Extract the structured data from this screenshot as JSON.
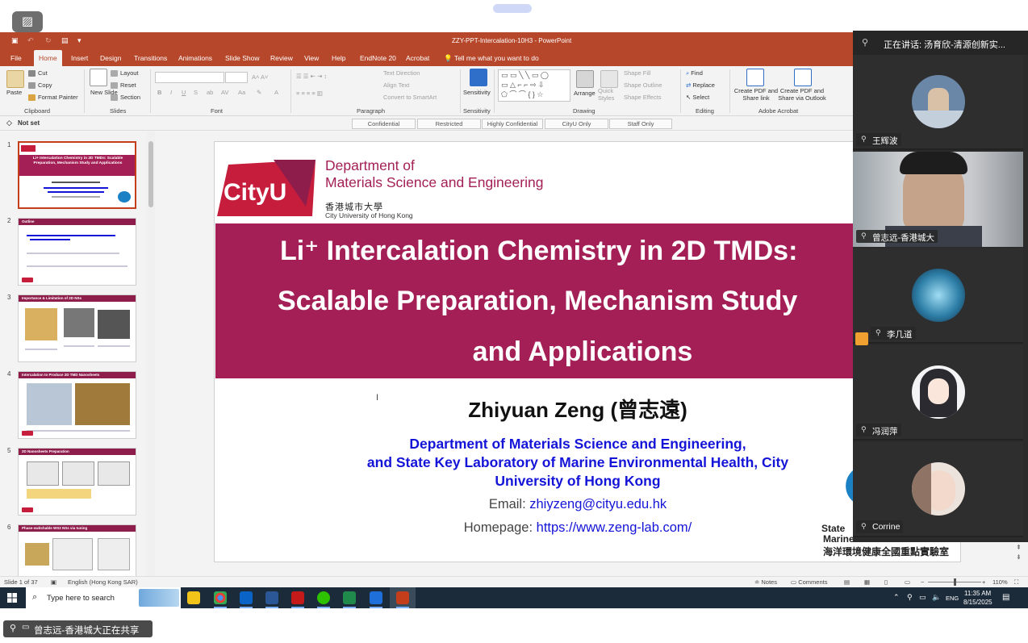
{
  "meeting": {
    "speaker_label": "正在讲话: 汤育欣-清源创新实...",
    "share_label": "曾志远-香港城大正在共享",
    "participants": [
      "王辉波",
      "曾志远-香港城大",
      "李几道",
      "冯润萍",
      "Corrine"
    ]
  },
  "window": {
    "title": "ZZY-PPT-Intercalation-10H3  -  PowerPoint",
    "tabs": [
      "File",
      "Home",
      "Insert",
      "Design",
      "Transitions",
      "Animations",
      "Slide Show",
      "Review",
      "View",
      "Help",
      "EndNote 20",
      "Acrobat"
    ],
    "tell_me": "Tell me what you want to do"
  },
  "ribbon": {
    "clipboard": {
      "paste": "Paste",
      "cut": "Cut",
      "copy": "Copy",
      "format_painter": "Format Painter",
      "label": "Clipboard"
    },
    "slides": {
      "new_slide": "New Slide",
      "layout": "Layout",
      "reset": "Reset",
      "section": "Section",
      "label": "Slides"
    },
    "font": {
      "label": "Font"
    },
    "paragraph": {
      "text_direction": "Text Direction",
      "align_text": "Align Text",
      "convert_smartart": "Convert to SmartArt",
      "label": "Paragraph"
    },
    "sensitivity": {
      "button": "Sensitivity",
      "label": "Sensitivity"
    },
    "drawing": {
      "arrange": "Arrange",
      "quick_styles": "Quick Styles",
      "shape_fill": "Shape Fill",
      "shape_outline": "Shape Outline",
      "shape_effects": "Shape Effects",
      "label": "Drawing"
    },
    "editing": {
      "find": "Find",
      "replace": "Replace",
      "select": "Select",
      "label": "Editing"
    },
    "acrobat": {
      "create_pdf_share_link": "Create PDF and Share link",
      "create_pdf_outlook": "Create PDF and Share via Outlook",
      "label": "Adobe Acrobat"
    }
  },
  "sensitivity_bar": {
    "status": "Not set",
    "labels": [
      "Confidential",
      "Restricted",
      "Highly Confidential",
      "CityU Only",
      "Staff Only"
    ]
  },
  "thumbnails": [
    {
      "num": "1",
      "title": "Li+ Intercalation Chemistry in 2D TMDs: Scalable Preparation, Mechanism Study and Applications"
    },
    {
      "num": "2",
      "title": "Outline"
    },
    {
      "num": "3",
      "title": "Importance & Limitation of 2D NSs"
    },
    {
      "num": "4",
      "title": "Intercalation to Produce 2D TMD Nanosheets"
    },
    {
      "num": "5",
      "title": "2D Nanosheets Preparation"
    },
    {
      "num": "6",
      "title": "Phase-switchable WS2 NSs via tuning"
    }
  ],
  "slide": {
    "dept_line1": "Department of",
    "dept_line2": "Materials Science and Engineering",
    "logo_text": "CityU",
    "univ_cn": "香港城市大學",
    "univ_en": "City University of Hong Kong",
    "title_line1": "Li⁺ Intercalation Chemistry in 2D TMDs:",
    "title_line2": "Scalable Preparation, Mechanism Study",
    "title_line3": "and Applications",
    "author": "Zhiyuan Zeng (曾志遠)",
    "aff_line1": "Department of Materials Science and Engineering,",
    "aff_line2": "and State Key Laboratory of Marine Environmental Health, City",
    "aff_line3": "University of Hong Kong",
    "email_label": "Email: ",
    "email": "zhiyzeng@cityu.edu.hk",
    "homepage_label": "Homepage: ",
    "homepage": "https://www.zeng-lab.com/",
    "skl_line1": "State",
    "skl_line2": "Marine",
    "skl_line3": "海洋環境健康全國重點實驗室"
  },
  "statusbar": {
    "slide_count": "Slide 1 of 37",
    "language": "English (Hong Kong SAR)",
    "notes": "Notes",
    "comments": "Comments",
    "zoom": "110%"
  },
  "taskbar": {
    "search_placeholder": "Type here to search",
    "language": "ENG",
    "time": "11:35 AM",
    "date": "8/15/2025"
  },
  "colors": {
    "ppt_accent": "#b7472a",
    "cityu_magenta": "#a31f55",
    "link_blue": "#1414d8"
  }
}
